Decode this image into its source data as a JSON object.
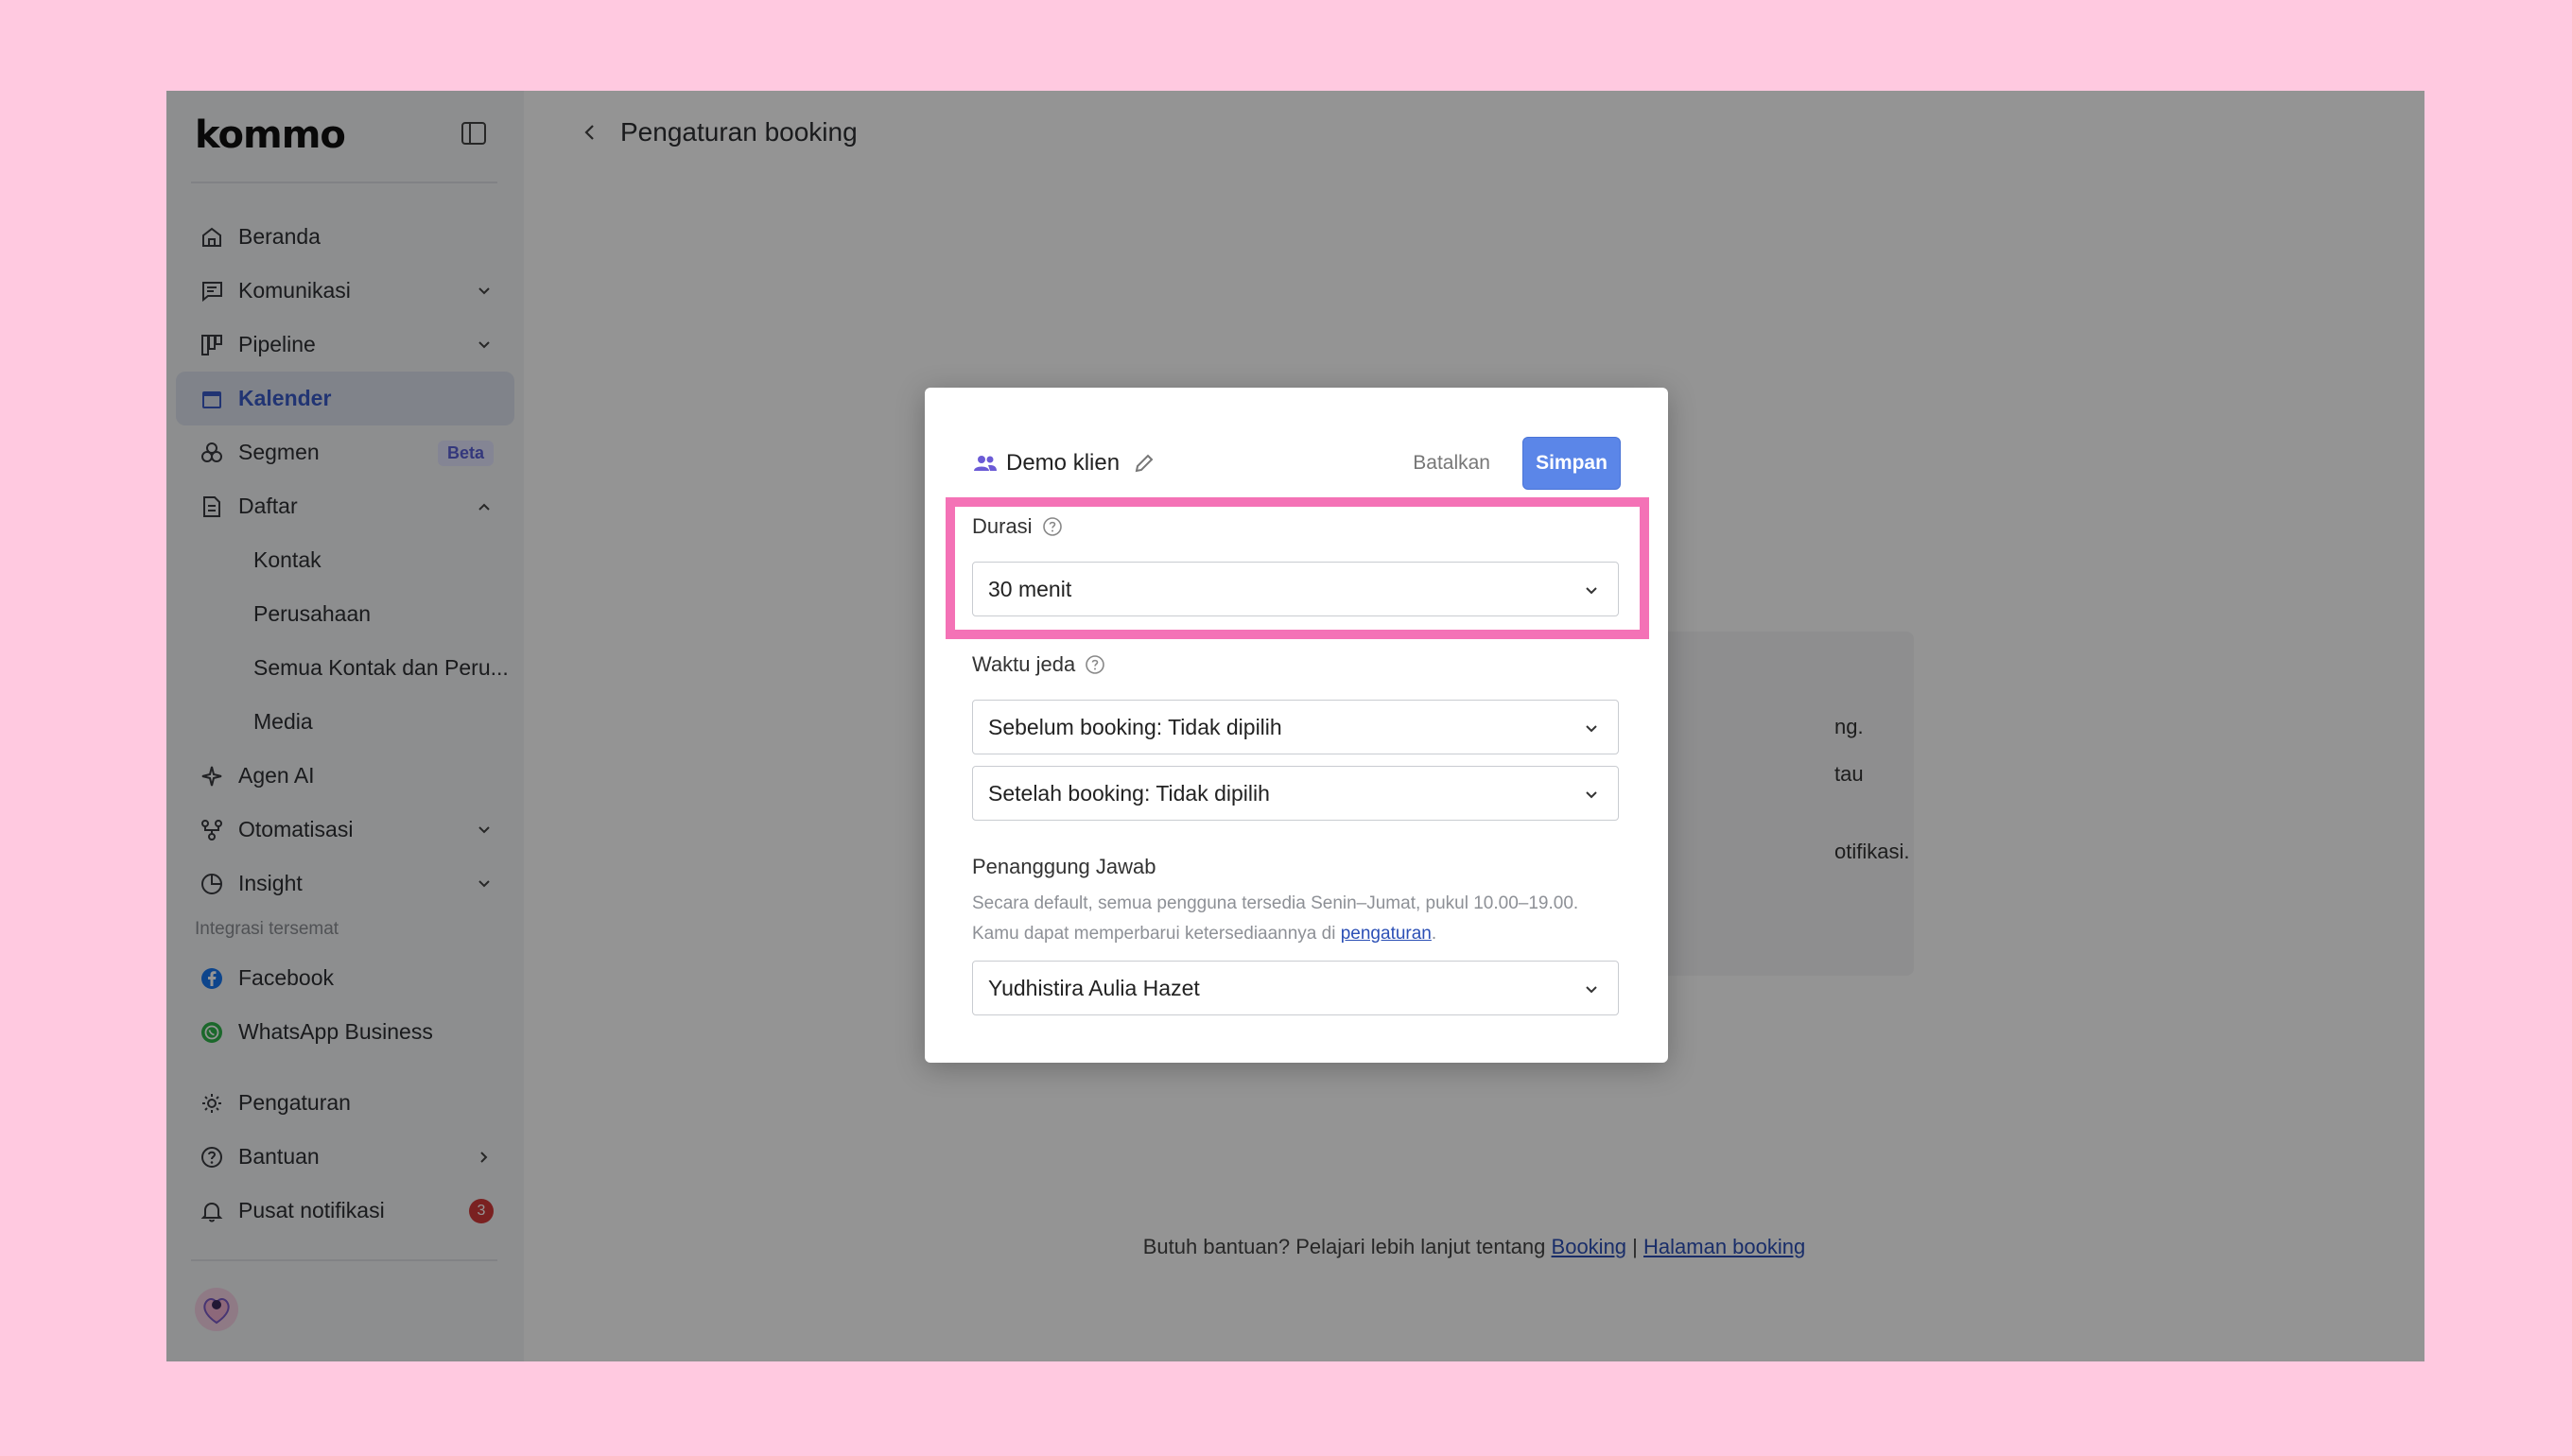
{
  "app": {
    "logo": "kommo"
  },
  "sidebar": {
    "items": [
      {
        "label": "Beranda",
        "icon": "home-icon"
      },
      {
        "label": "Komunikasi",
        "icon": "chat-icon"
      },
      {
        "label": "Pipeline",
        "icon": "pipeline-icon"
      },
      {
        "label": "Kalender",
        "icon": "calendar-icon"
      },
      {
        "label": "Segmen",
        "icon": "segment-icon",
        "badge": "Beta"
      },
      {
        "label": "Daftar",
        "icon": "list-icon"
      }
    ],
    "sub_items": [
      "Kontak",
      "Perusahaan",
      "Semua Kontak dan Peru...",
      "Media"
    ],
    "items_after": [
      {
        "label": "Agen AI",
        "icon": "sparkle-icon"
      },
      {
        "label": "Otomatisasi",
        "icon": "automation-icon"
      },
      {
        "label": "Insight",
        "icon": "chart-icon"
      }
    ],
    "integrations_label": "Integrasi tersemat",
    "integrations": [
      {
        "label": "Facebook",
        "icon": "facebook-icon"
      },
      {
        "label": "WhatsApp Business",
        "icon": "whatsapp-icon"
      }
    ],
    "bottom": [
      {
        "label": "Pengaturan",
        "icon": "gear-icon"
      },
      {
        "label": "Bantuan",
        "icon": "help-icon"
      },
      {
        "label": "Pusat notifikasi",
        "icon": "bell-icon",
        "count": "3"
      }
    ]
  },
  "main": {
    "title": "Pengaturan booking",
    "bg_text": [
      "ng.",
      "tau",
      "otifikasi."
    ],
    "help_text": "Butuh bantuan? Pelajari lebih lanjut tentang",
    "help_link1": "Booking",
    "help_sep": "|",
    "help_link2": "Halaman booking"
  },
  "modal": {
    "title": "Demo klien",
    "cancel_label": "Batalkan",
    "save_label": "Simpan",
    "duration_label": "Durasi",
    "duration_value": "30 menit",
    "break_label": "Waktu jeda",
    "before_value": "Sebelum booking: Tidak dipilih",
    "after_value": "Setelah booking: Tidak dipilih",
    "owner_label": "Penanggung Jawab",
    "owner_desc_line1": "Secara default, semua pengguna tersedia Senin–Jumat, pukul 10.00–19.00.",
    "owner_desc_line2_prefix": "Kamu dapat memperbarui ketersediaannya di",
    "owner_desc_link": "pengaturan",
    "owner_desc_suffix": ".",
    "owner_value": "Yudhistira Aulia Hazet"
  },
  "colors": {
    "background": "#ffc9e0",
    "accent": "#5b86e8",
    "active_nav": "#3a5bc7",
    "highlight": "#f472b6"
  }
}
